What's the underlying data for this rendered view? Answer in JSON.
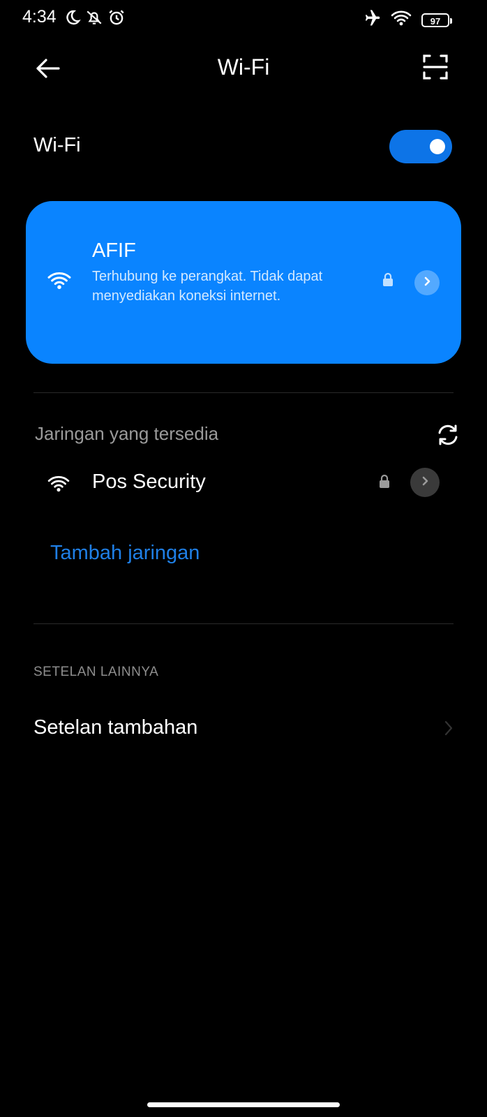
{
  "status_bar": {
    "time": "4:34",
    "icons_left": [
      "moon-icon",
      "bell-off-icon",
      "alarm-icon"
    ],
    "icons_right": [
      "airplane-icon",
      "wifi-icon",
      "battery-icon"
    ],
    "battery_level": "97"
  },
  "header": {
    "title": "Wi-Fi",
    "back_icon": "arrow-left-icon",
    "scan_icon": "scan-icon"
  },
  "wifi_toggle": {
    "label": "Wi-Fi",
    "enabled": true,
    "accent_color": "#0d74e7"
  },
  "connected_network": {
    "ssid": "AFIF",
    "status": "Terhubung ke perangkat. Tidak dapat menyediakan koneksi internet.",
    "secured": true,
    "card_color": "#0a84ff"
  },
  "available_networks": {
    "title": "Jaringan yang tersedia",
    "refresh_icon": "refresh-icon",
    "items": [
      {
        "ssid": "Pos Security",
        "secured": true
      }
    ],
    "add_network_label": "Tambah jaringan",
    "link_color": "#1f7fe6"
  },
  "other_settings": {
    "title": "SETELAN LAINNYA",
    "items": [
      {
        "label": "Setelan tambahan"
      }
    ]
  }
}
